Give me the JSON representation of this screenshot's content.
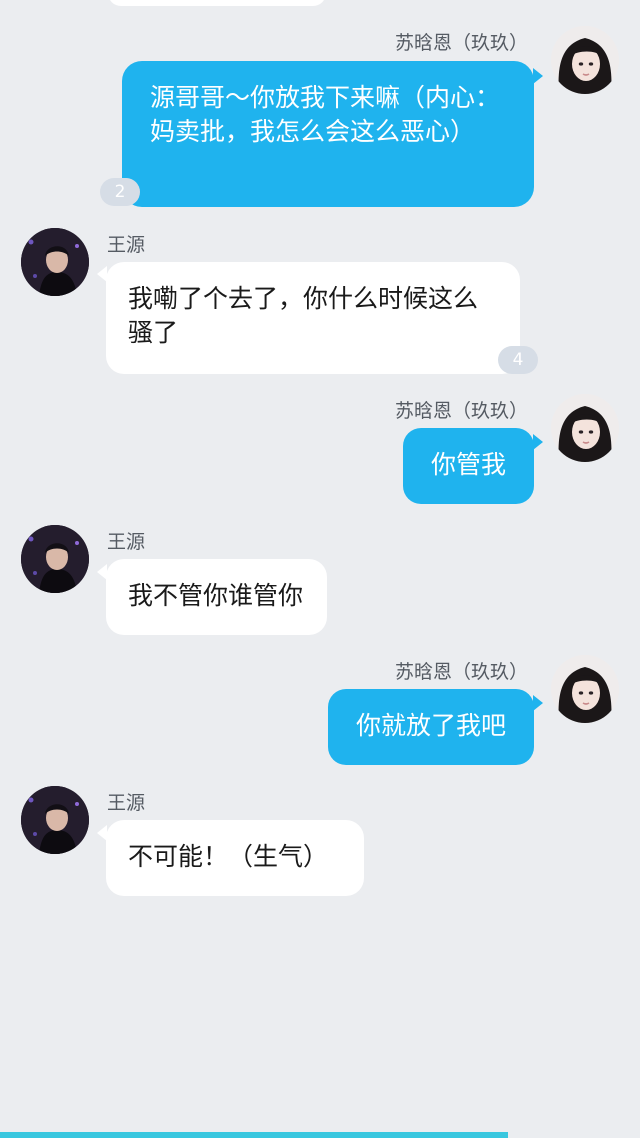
{
  "messages": [
    {
      "sender": "苏晗恩（玖玖）",
      "text": "源哥哥～你放我下来嘛（内心：妈卖批，我怎么会这么恶心）",
      "badge": "2"
    },
    {
      "sender": "王源",
      "text": "我嘞了个去了，你什么时候这么骚了",
      "badge": "4"
    },
    {
      "sender": "苏晗恩（玖玖）",
      "text": "你管我"
    },
    {
      "sender": "王源",
      "text": "我不管你谁管你"
    },
    {
      "sender": "苏晗恩（玖玖）",
      "text": "你就放了我吧"
    },
    {
      "sender": "王源",
      "text": "不可能！（生气）"
    }
  ],
  "colors": {
    "background": "#ebedf0",
    "outgoing_bubble": "#1fb3ee",
    "incoming_bubble": "#ffffff",
    "badge": "#d6dde6",
    "bottom_bar": "#38c7df"
  }
}
